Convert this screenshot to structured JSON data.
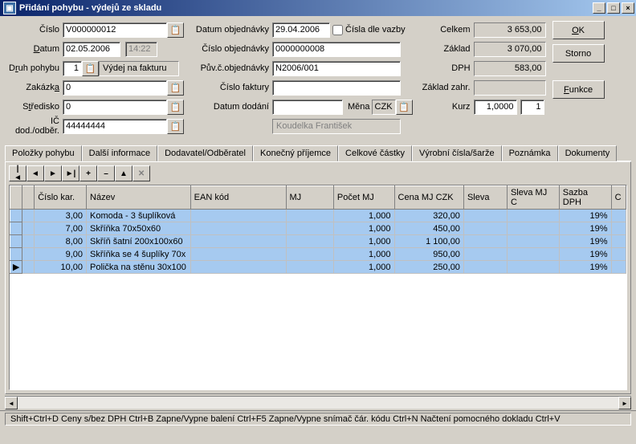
{
  "window": {
    "title": "Přidání pohybu - výdejů ze skladu"
  },
  "form": {
    "cislo_label": "Číslo",
    "cislo": "V000000012",
    "datum_label": "Datum",
    "datum": "02.05.2006",
    "time": "14:22",
    "druh_pohybu_label": "Druh pohybu",
    "druh_pohybu_num": "1",
    "druh_pohybu_text": "Výdej na fakturu",
    "zakazka_label": "Zakázka",
    "zakazka": "0",
    "stredisko_label": "Středisko",
    "stredisko": "0",
    "ic_label": "IČ dod./odběr.",
    "ic": "44444444",
    "partner_name": "Koudelka František",
    "datum_obj_label": "Datum objednávky",
    "datum_obj": "29.04.2006",
    "cisla_dle_vazby_label": "Čísla dle vazby",
    "cislo_obj_label": "Číslo objednávky",
    "cislo_obj": "0000000008",
    "puvc_label": "Pův.č.objednávky",
    "puvc": "N2006/001",
    "cislo_fak_label": "Číslo faktury",
    "cislo_fak": "",
    "datum_dodani_label": "Datum dodání",
    "datum_dodani": "",
    "mena_label": "Měna",
    "mena": "CZK",
    "kurz_label": "Kurz",
    "kurz": "1,0000",
    "kurz_qty": "1",
    "celkem_label": "Celkem",
    "celkem": "3 653,00",
    "zaklad_label": "Základ",
    "zaklad": "3 070,00",
    "dph_label": "DPH",
    "dph": "583,00",
    "zaklad_zahr_label": "Základ zahr.",
    "zaklad_zahr": ""
  },
  "buttons": {
    "ok": "OK",
    "storno": "Storno",
    "funkce": "Funkce"
  },
  "tabs": [
    "Položky pohybu",
    "Další informace",
    "Dodavatel/Odběratel",
    "Konečný příjemce",
    "Celkové částky",
    "Výrobní čísla/šarže",
    "Poznámka",
    "Dokumenty"
  ],
  "grid": {
    "headers": [
      "Číslo kar.",
      "Název",
      "EAN kód",
      "MJ",
      "Počet MJ",
      "Cena MJ CZK",
      "Sleva",
      "Sleva MJ C",
      "Sazba DPH",
      "C"
    ],
    "rows": [
      {
        "cislo": "3,00",
        "nazev": "Komoda - 3 šuplíková",
        "ean": "",
        "mj": "",
        "pocet": "1,000",
        "cena": "320,00",
        "sleva": "",
        "slevamj": "",
        "sazba": "19%"
      },
      {
        "cislo": "7,00",
        "nazev": "Skříňka  70x50x60",
        "ean": "",
        "mj": "",
        "pocet": "1,000",
        "cena": "450,00",
        "sleva": "",
        "slevamj": "",
        "sazba": "19%"
      },
      {
        "cislo": "8,00",
        "nazev": "Skříň šatní 200x100x60",
        "ean": "",
        "mj": "",
        "pocet": "1,000",
        "cena": "1 100,00",
        "sleva": "",
        "slevamj": "",
        "sazba": "19%"
      },
      {
        "cislo": "9,00",
        "nazev": "Skříňka se 4 šuplíky 70x",
        "ean": "",
        "mj": "",
        "pocet": "1,000",
        "cena": "950,00",
        "sleva": "",
        "slevamj": "",
        "sazba": "19%"
      },
      {
        "cislo": "10,00",
        "nazev": "Polička na stěnu 30x100",
        "ean": "",
        "mj": "",
        "pocet": "1,000",
        "cena": "250,00",
        "sleva": "",
        "slevamj": "",
        "sazba": "19%"
      }
    ]
  },
  "statusbar": "Shift+Ctrl+D Ceny s/bez DPH Ctrl+B Zapne/Vypne balení  Ctrl+F5 Zapne/Vypne snímač čár. kódu  Ctrl+N Načtení pomocného dokladu  Ctrl+V"
}
